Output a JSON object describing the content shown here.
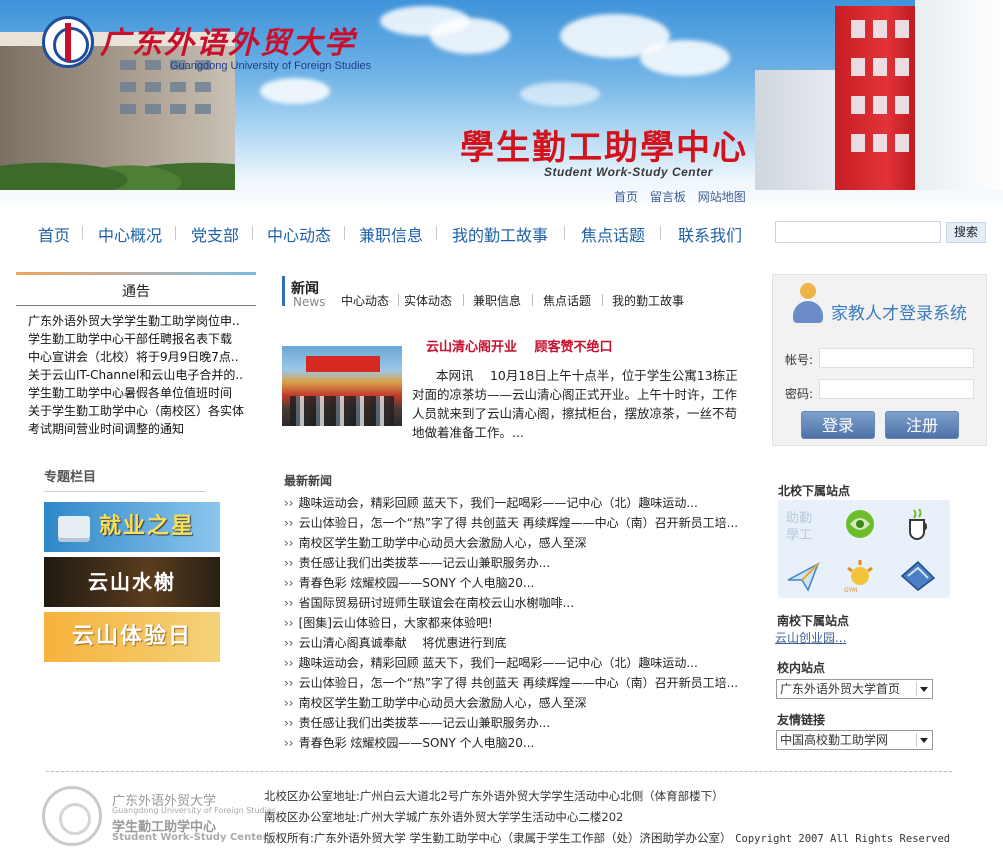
{
  "header": {
    "logo_cn": "广东外语外贸大学",
    "logo_en": "Guangdong University of Foreign Studies",
    "center_title_cn": "學生勤工助學中心",
    "center_title_en": "Student Work-Study Center",
    "quick_links": [
      "首页",
      "留言板",
      "网站地图"
    ]
  },
  "nav": {
    "items": [
      "首页",
      "中心概况",
      "党支部",
      "中心动态",
      "兼职信息",
      "我的勤工故事",
      "焦点话题",
      "联系我们"
    ],
    "search_button": "搜索"
  },
  "notice": {
    "title": "通告",
    "items": [
      "广东外语外贸大学学生勤工助学岗位申..",
      "学生勤工助学中心干部任聘报名表下载",
      "中心宣讲会（北校）将于9月9日晚7点..",
      "关于云山IT-Channel和云山电子合并的..",
      "学生勤工助学中心暑假各单位值班时间",
      "关于学生勤工助学中心（南校区）各实体",
      "考试期间营业时间调整的通知"
    ]
  },
  "topics": {
    "title": "专题栏目",
    "banners": [
      "就业之星",
      "云山水榭",
      "云山体验日"
    ]
  },
  "news": {
    "title_cn": "新闻",
    "title_en": "News",
    "tabs": [
      "中心动态",
      "实体动态",
      "兼职信息",
      "焦点话题",
      "我的勤工故事"
    ],
    "feature_title": "云山清心阁开业　 顾客赞不绝口",
    "feature_text": "本网讯　 10月18日上午十点半，位于学生公寓13栋正对面的凉茶坊——云山清心阁正式开业。上午十时许，工作人员就来到了云山清心阁，擦拭柜台，摆放凉茶，一丝不苟地做着准备工作。..."
  },
  "latest": {
    "title": "最新新闻",
    "items": [
      "趣味运动会，精彩回顾  蓝天下，我们一起喝彩——记中心（北）趣味运动...",
      "云山体验日，怎一个“热”字了得 共创蓝天  再续辉煌——中心（南）召开新员工培...",
      "南校区学生勤工助学中心动员大会激励人心，感人至深",
      "责任感让我们出类拔萃——记云山兼职服务办...",
      "青春色彩 炫耀校园——SONY 个人电脑20...",
      "省国际贸易研讨班师生联谊会在南校云山水榭咖啡...",
      "[图集]云山体验日，大家都来体验吧!",
      "云山清心阁真诚奉献　 将优惠进行到底",
      "趣味运动会，精彩回顾  蓝天下，我们一起喝彩——记中心（北）趣味运动...",
      "云山体验日，怎一个“热”字了得 共创蓝天  再续辉煌——中心（南）召开新员工培...",
      "南校区学生勤工助学中心动员大会激励人心，感人至深",
      "责任感让我们出类拔萃——记云山兼职服务办...",
      "青春色彩 炫耀校园——SONY 个人电脑20..."
    ]
  },
  "login": {
    "title": "家教人才登录系统",
    "account_label": "帐号:",
    "password_label": "密码:",
    "login_button": "登录",
    "register_button": "注册"
  },
  "sidebar": {
    "north_title": "北校下属站点",
    "south_title": "南校下属站点",
    "south_link": "云山创业园...",
    "campus_title": "校内站点",
    "campus_select": "广东外语外贸大学首页",
    "friend_title": "友情链接",
    "friend_select": "中国高校勤工助学网"
  },
  "footer": {
    "logo_l1": "广东外语外贸大学",
    "logo_l2": "Guangdong University of Foreign Studies",
    "logo_l3": "学生勤工助学中心",
    "logo_l4": "Student Work-Study Center",
    "line1": "北校区办公室地址:广州白云大道北2号广东外语外贸大学学生活动中心北侧（体育部楼下）",
    "line2": "南校区办公室地址:广州大学城广东外语外贸大学学生活动中心二楼202",
    "line3": "版权所有:广东外语外贸大学 学生勤工助学中心（隶属于学生工作部（处）济困助学办公室）",
    "copyright": "Copyright  2007 All Rights Reserved"
  },
  "colors": {
    "accent_blue": "#1e62a9",
    "brand_red": "#c8102e"
  }
}
